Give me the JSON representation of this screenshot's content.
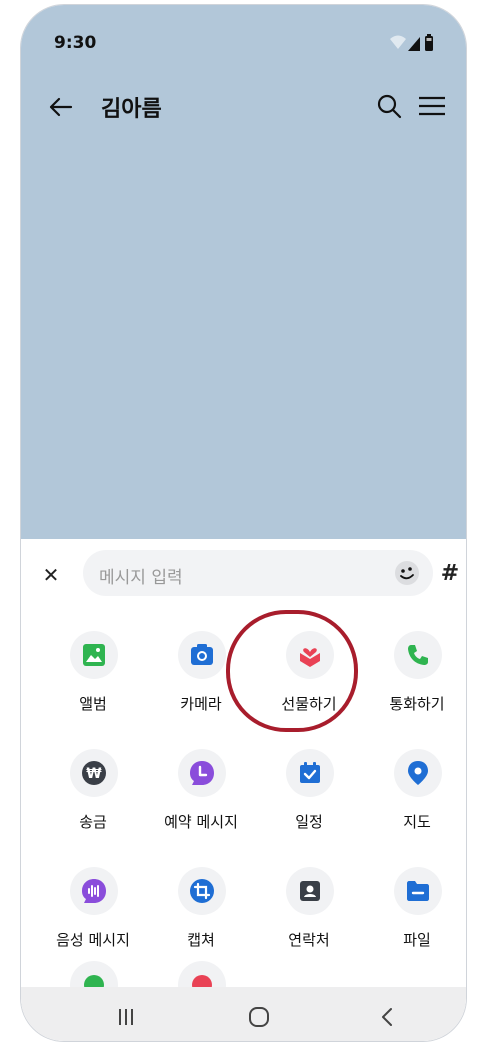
{
  "status": {
    "time": "9:30"
  },
  "header": {
    "title": "김아름"
  },
  "composer": {
    "placeholder": "메시지 입력",
    "hash_label": "#"
  },
  "menu": [
    {
      "label": "앨범",
      "icon": "album-icon",
      "color": "#2fb450"
    },
    {
      "label": "카메라",
      "icon": "camera-icon",
      "color": "#1f6ed4"
    },
    {
      "label": "선물하기",
      "icon": "gift-icon",
      "color": "#e94255"
    },
    {
      "label": "통화하기",
      "icon": "phone-icon",
      "color": "#2fb450"
    },
    {
      "label": "송금",
      "icon": "won-icon",
      "color": "#3a3f47"
    },
    {
      "label": "예약 메시지",
      "icon": "schedule-message-icon",
      "color": "#8a4ddb"
    },
    {
      "label": "일정",
      "icon": "calendar-icon",
      "color": "#1f6ed4"
    },
    {
      "label": "지도",
      "icon": "map-pin-icon",
      "color": "#1f6ed4"
    },
    {
      "label": "음성 메시지",
      "icon": "voice-message-icon",
      "color": "#8a4ddb"
    },
    {
      "label": "캡쳐",
      "icon": "capture-icon",
      "color": "#1f6ed4"
    },
    {
      "label": "연락처",
      "icon": "contact-icon",
      "color": "#3a3f47"
    },
    {
      "label": "파일",
      "icon": "file-icon",
      "color": "#1f6ed4"
    }
  ]
}
